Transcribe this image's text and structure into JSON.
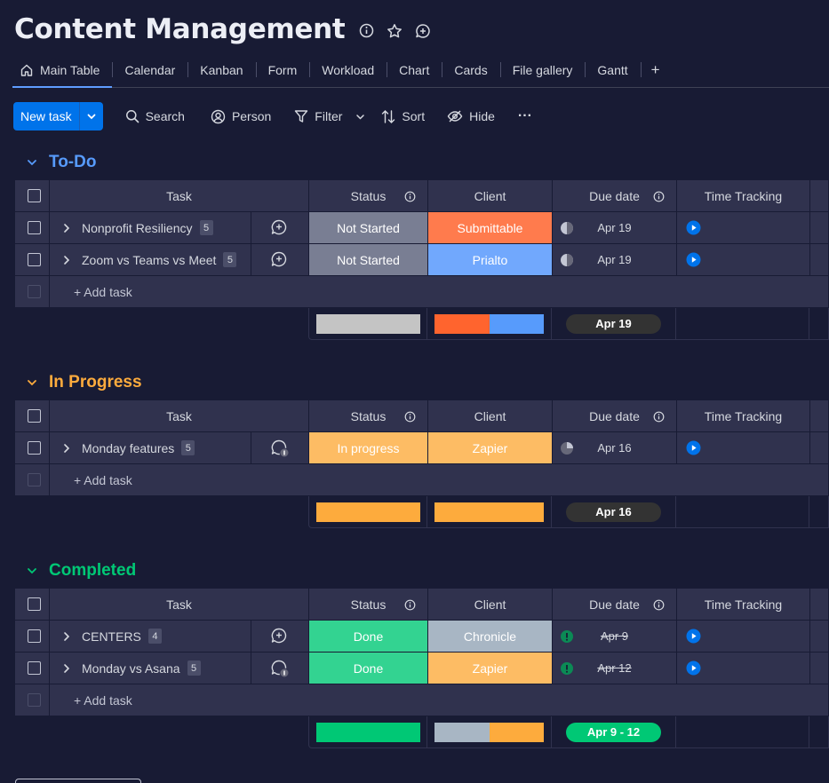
{
  "page": {
    "title": "Content Management"
  },
  "tabs": [
    {
      "label": "Main Table",
      "active": true,
      "icon": "home-icon"
    },
    {
      "label": "Calendar"
    },
    {
      "label": "Kanban"
    },
    {
      "label": "Form"
    },
    {
      "label": "Workload"
    },
    {
      "label": "Chart"
    },
    {
      "label": "Cards"
    },
    {
      "label": "File gallery"
    },
    {
      "label": "Gantt"
    },
    {
      "label": "+"
    }
  ],
  "toolbar": {
    "new_task": "New task",
    "search": "Search",
    "person": "Person",
    "filter": "Filter",
    "sort": "Sort",
    "hide": "Hide",
    "more": "···"
  },
  "columns": {
    "task": "Task",
    "status": "Status",
    "client": "Client",
    "due_date": "Due date",
    "time_tracking": "Time Tracking"
  },
  "add_task": "+ Add task",
  "colors": {
    "todo": "#579bfc",
    "in_progress": "#fdab3d",
    "completed": "#00c875",
    "not_started": "#797e93",
    "in_progress_status": "#fdbc64",
    "done": "#33d391",
    "submittable": "#ff7b4d",
    "prialto": "#71a8fd",
    "zapier": "#fdbc64",
    "chronicle": "#a8b6c4",
    "accent": "#0073ea"
  },
  "groups": [
    {
      "name": "To-Do",
      "color": "#579bfc",
      "rows": [
        {
          "task": "Nonprofit Resiliency",
          "count": "5",
          "status": "Not Started",
          "status_color": "#797e93",
          "client": "Submittable",
          "client_color": "#ff7b4d",
          "date": "Apr 19",
          "date_icon": "half-circle-icon",
          "strike": false
        },
        {
          "task": "Zoom vs Teams vs Meet",
          "count": "5",
          "status": "Not Started",
          "status_color": "#797e93",
          "client": "Prialto",
          "client_color": "#71a8fd",
          "date": "Apr 19",
          "date_icon": "half-circle-icon",
          "strike": false
        }
      ],
      "summary": {
        "date": "Apr 19",
        "pill_color": "#333333"
      }
    },
    {
      "name": "In Progress",
      "color": "#fdab3d",
      "rows": [
        {
          "task": "Monday features",
          "count": "5",
          "status": "In progress",
          "status_color": "#fdbc64",
          "client": "Zapier",
          "client_color": "#fdbc64",
          "date": "Apr 16",
          "date_icon": "pie-icon",
          "strike": false
        }
      ],
      "summary": {
        "date": "Apr 16",
        "pill_color": "#333333"
      }
    },
    {
      "name": "Completed",
      "color": "#00c875",
      "rows": [
        {
          "task": "CENTERS",
          "count": "4",
          "status": "Done",
          "status_color": "#33d391",
          "client": "Chronicle",
          "client_color": "#a8b6c4",
          "date": "Apr 9",
          "date_icon": "alert-icon",
          "strike": true
        },
        {
          "task": "Monday vs Asana",
          "count": "5",
          "status": "Done",
          "status_color": "#33d391",
          "client": "Zapier",
          "client_color": "#fdbc64",
          "date": "Apr 12",
          "date_icon": "alert-icon",
          "strike": true
        }
      ],
      "summary": {
        "date": "Apr 9 - 12",
        "pill_color": "#00c875"
      }
    }
  ]
}
